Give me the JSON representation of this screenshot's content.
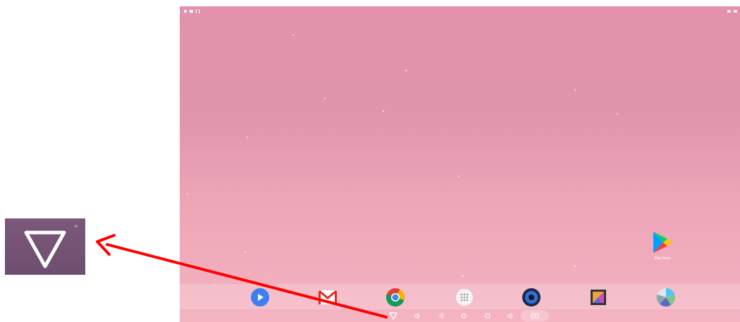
{
  "desktop": {
    "apps": [
      {
        "label": "Play Store",
        "icon": "play-store-icon"
      }
    ]
  },
  "dock": {
    "apps": [
      {
        "icon": "play-movies-icon"
      },
      {
        "icon": "gmail-icon"
      },
      {
        "icon": "chrome-icon"
      },
      {
        "icon": "app-drawer-icon"
      },
      {
        "icon": "music-speaker-icon"
      },
      {
        "icon": "gallery-icon"
      },
      {
        "icon": "camera-aperture-icon"
      }
    ]
  },
  "nav_bar": {
    "buttons": [
      {
        "icon": "hide-navbar-triangle-icon"
      },
      {
        "icon": "volume-down-icon"
      },
      {
        "icon": "back-icon"
      },
      {
        "icon": "home-icon"
      },
      {
        "icon": "recents-icon"
      },
      {
        "icon": "volume-up-icon"
      },
      {
        "icon": "screenshot-icon"
      }
    ]
  },
  "annotation": {
    "arrow_color": "#ff0000",
    "zoom_target": "hide-navbar-triangle-icon"
  },
  "colors": {
    "wallpaper_top": "#e293ab",
    "wallpaper_bottom": "#f4b4c2",
    "zoom_background": "#7b5879"
  }
}
